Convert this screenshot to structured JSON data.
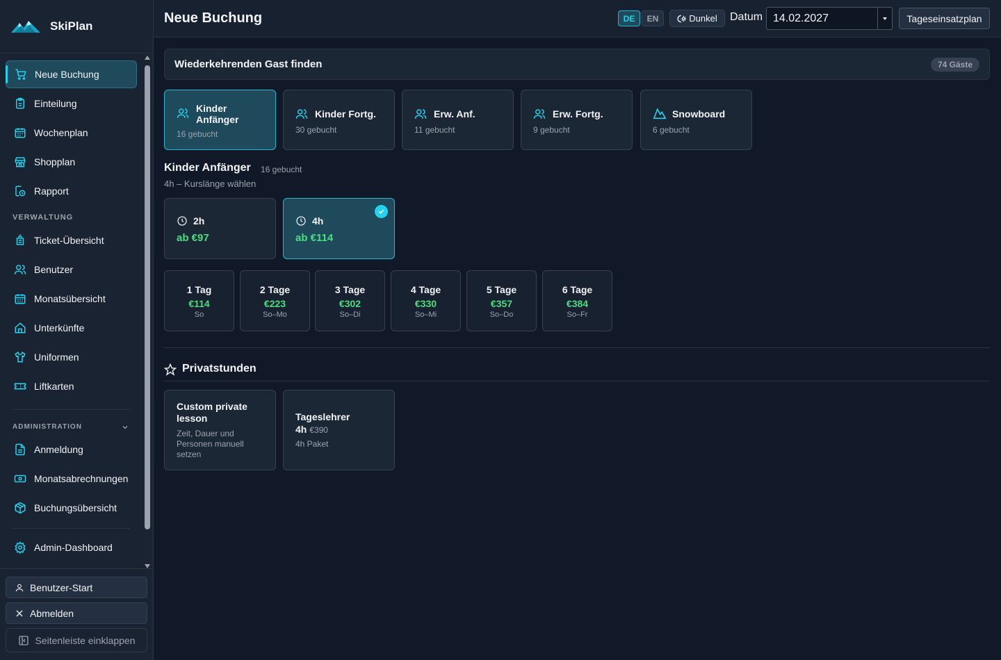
{
  "app": {
    "name": "SkiPlan"
  },
  "sidebar": {
    "items": [
      {
        "label": "Neue Buchung",
        "icon": "cart-icon",
        "active": true
      },
      {
        "label": "Einteilung",
        "icon": "clipboard-icon"
      },
      {
        "label": "Wochenplan",
        "icon": "calendar-icon"
      },
      {
        "label": "Shopplan",
        "icon": "store-icon"
      },
      {
        "label": "Rapport",
        "icon": "report-clock-icon"
      }
    ],
    "verwaltung_label": "VERWALTUNG",
    "verwaltung_items": [
      {
        "label": "Ticket-Übersicht",
        "icon": "ticket-stack-icon"
      },
      {
        "label": "Benutzer",
        "icon": "users-icon"
      },
      {
        "label": "Monatsübersicht",
        "icon": "calendar-grid-icon"
      },
      {
        "label": "Unterkünfte",
        "icon": "home-icon"
      },
      {
        "label": "Uniformen",
        "icon": "shirt-icon"
      },
      {
        "label": "Liftkarten",
        "icon": "ticket-icon"
      }
    ],
    "admin_label": "ADMINISTRATION",
    "admin_items": [
      {
        "label": "Anmeldung",
        "icon": "document-icon"
      },
      {
        "label": "Monatsabrechnungen",
        "icon": "money-icon"
      },
      {
        "label": "Buchungsübersicht",
        "icon": "box-icon"
      }
    ],
    "dashboard_label": "Admin-Dashboard",
    "user_start": "Benutzer-Start",
    "logout": "Abmelden",
    "collapse": "Seitenleiste einklappen"
  },
  "header": {
    "title": "Neue Buchung",
    "lang_de": "DE",
    "lang_en": "EN",
    "theme": "Dunkel",
    "date_label": "Datum",
    "date_value": "14.02.2027",
    "day_plan_button": "Tageseinsatzplan"
  },
  "guest_search": {
    "title": "Wiederkehrenden Gast finden",
    "badge": "74 Gäste"
  },
  "categories": [
    {
      "name_line1": "Kinder",
      "name_line2": "Anfänger",
      "booked": "16 gebucht",
      "icon": "users-icon",
      "active": true
    },
    {
      "name_line1": "Kinder Fortg.",
      "booked": "30 gebucht",
      "icon": "users-icon"
    },
    {
      "name_line1": "Erw. Anf.",
      "booked": "11 gebucht",
      "icon": "users-icon"
    },
    {
      "name_line1": "Erw. Fortg.",
      "booked": "9 gebucht",
      "icon": "users-icon"
    },
    {
      "name_line1": "Snowboard",
      "booked": "6 gebucht",
      "icon": "mountain-icon"
    }
  ],
  "section": {
    "title": "Kinder Anfänger",
    "count": "16 gebucht",
    "subtitle": "4h – Kurslänge wählen"
  },
  "durations": [
    {
      "label": "2h",
      "price": "ab €97"
    },
    {
      "label": "4h",
      "price": "ab €114",
      "selected": true
    }
  ],
  "days": [
    {
      "label": "1 Tag",
      "price": "€114",
      "range": "So"
    },
    {
      "label": "2 Tage",
      "price": "€223",
      "range": "So–Mo"
    },
    {
      "label": "3 Tage",
      "price": "€302",
      "range": "So–Di"
    },
    {
      "label": "4 Tage",
      "price": "€330",
      "range": "So–Mi"
    },
    {
      "label": "5 Tage",
      "price": "€357",
      "range": "So–Do"
    },
    {
      "label": "6 Tage",
      "price": "€384",
      "range": "So–Fr"
    }
  ],
  "private": {
    "title": "Privatstunden",
    "custom_title_1": "Custom private",
    "custom_title_2": "lesson",
    "custom_desc_1": "Zeit, Dauer und",
    "custom_desc_2": "Personen manuell",
    "custom_desc_3": "setzen",
    "teacher_title": "Tageslehrer",
    "teacher_hours": "4h",
    "teacher_price": "€390",
    "teacher_sub": "4h Paket"
  },
  "colors": {
    "accent": "#22d3ee",
    "price": "#4ade80",
    "bg": "#111827",
    "sidebar": "#1a2332"
  }
}
